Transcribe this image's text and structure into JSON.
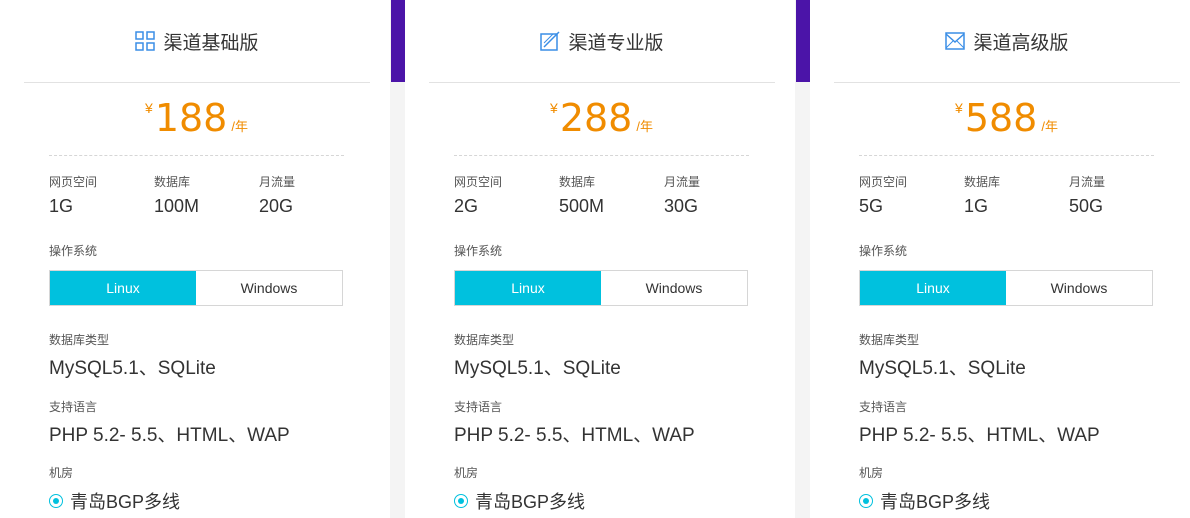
{
  "plans": [
    {
      "name": "渠道基础版",
      "icon": "grid-icon",
      "currency": "¥",
      "price": "188",
      "unit": "/年",
      "specs": [
        {
          "label": "网页空间",
          "value": "1G"
        },
        {
          "label": "数据库",
          "value": "100M"
        },
        {
          "label": "月流量",
          "value": "20G"
        }
      ],
      "os_label": "操作系统",
      "os_options": [
        "Linux",
        "Windows"
      ],
      "os_selected": "Linux",
      "db_label": "数据库类型",
      "db_value": "MySQL5.1、SQLite",
      "lang_label": "支持语言",
      "lang_value": "PHP 5.2- 5.5、HTML、WAP",
      "room_label": "机房",
      "room_value": "青岛BGP多线"
    },
    {
      "name": "渠道专业版",
      "icon": "pen-square-icon",
      "currency": "¥",
      "price": "288",
      "unit": "/年",
      "specs": [
        {
          "label": "网页空间",
          "value": "2G"
        },
        {
          "label": "数据库",
          "value": "500M"
        },
        {
          "label": "月流量",
          "value": "30G"
        }
      ],
      "os_label": "操作系统",
      "os_options": [
        "Linux",
        "Windows"
      ],
      "os_selected": "Linux",
      "db_label": "数据库类型",
      "db_value": "MySQL5.1、SQLite",
      "lang_label": "支持语言",
      "lang_value": "PHP 5.2- 5.5、HTML、WAP",
      "room_label": "机房",
      "room_value": "青岛BGP多线"
    },
    {
      "name": "渠道高级版",
      "icon": "envelope-square-icon",
      "currency": "¥",
      "price": "588",
      "unit": "/年",
      "specs": [
        {
          "label": "网页空间",
          "value": "5G"
        },
        {
          "label": "数据库",
          "value": "1G"
        },
        {
          "label": "月流量",
          "value": "50G"
        }
      ],
      "os_label": "操作系统",
      "os_options": [
        "Linux",
        "Windows"
      ],
      "os_selected": "Linux",
      "db_label": "数据库类型",
      "db_value": "MySQL5.1、SQLite",
      "lang_label": "支持语言",
      "lang_value": "PHP 5.2- 5.5、HTML、WAP",
      "room_label": "机房",
      "room_value": "青岛BGP多线"
    }
  ],
  "colors": {
    "accent": "#00c1de",
    "price": "#f08c00",
    "bar": "#4b14a8"
  }
}
